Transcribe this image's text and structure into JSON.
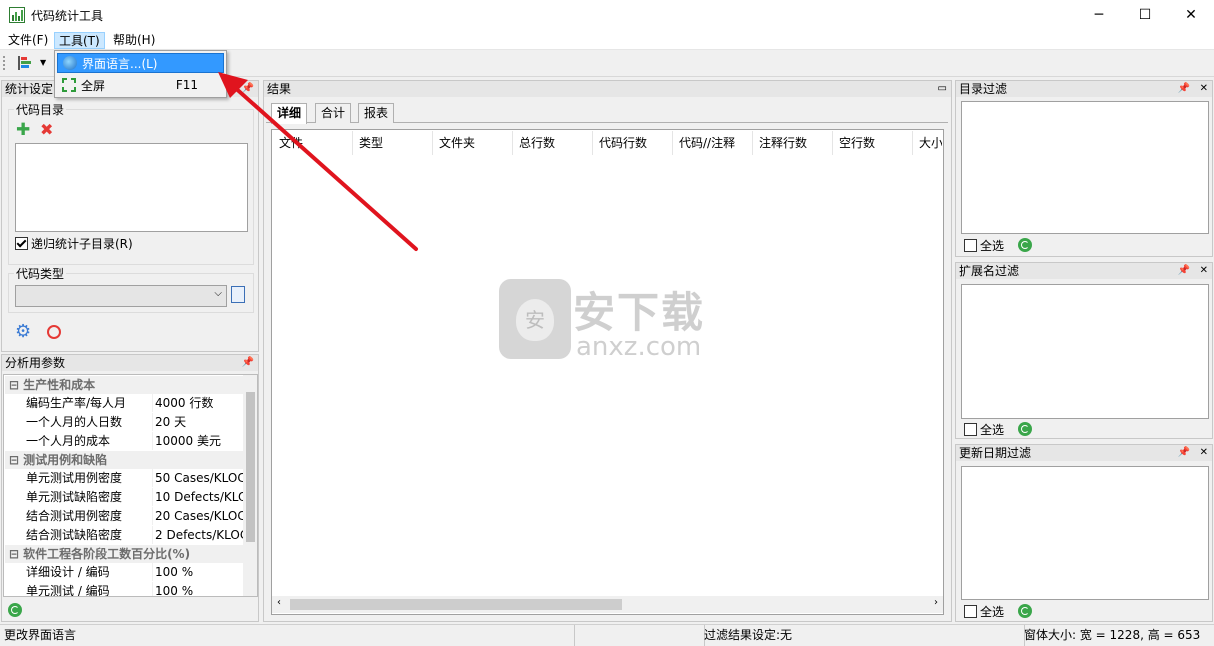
{
  "window": {
    "title": "代码统计工具",
    "min": "─",
    "max": "☐",
    "close": "✕"
  },
  "menu": {
    "file": "文件(F)",
    "tools": "工具(T)",
    "help": "帮助(H)"
  },
  "dropdown": {
    "items": [
      {
        "label": "界面语言...(L)",
        "shortcut": ""
      },
      {
        "label": "全屏",
        "shortcut": "F11"
      }
    ]
  },
  "stat_panel": {
    "title": "统计设定",
    "code_dir_label": "代码目录",
    "recurse_label": "递归统计子目录(R)",
    "recurse_checked": true,
    "code_type_label": "代码类型"
  },
  "params_panel": {
    "title": "分析用参数",
    "categories": [
      {
        "name": "生产性和成本",
        "rows": [
          {
            "name": "编码生产率/每人月",
            "value": "4000 行数"
          },
          {
            "name": "一个人月的人日数",
            "value": "20 天"
          },
          {
            "name": "一个人月的成本",
            "value": "10000 美元"
          }
        ]
      },
      {
        "name": "测试用例和缺陷",
        "rows": [
          {
            "name": "单元测试用例密度",
            "value": "50 Cases/KLOC"
          },
          {
            "name": "单元测试缺陷密度",
            "value": "10 Defects/KLOC"
          },
          {
            "name": "结合测试用例密度",
            "value": "20 Cases/KLOC"
          },
          {
            "name": "结合测试缺陷密度",
            "value": "2 Defects/KLOC"
          }
        ]
      },
      {
        "name": "软件工程各阶段工数百分比(%)",
        "rows": [
          {
            "name": "详细设计 / 编码",
            "value": "100 %"
          },
          {
            "name": "单元测试 / 编码",
            "value": "100 %"
          }
        ]
      }
    ]
  },
  "results": {
    "title": "结果",
    "tabs": [
      "详细",
      "合计",
      "报表"
    ],
    "columns": [
      "文件",
      "类型",
      "文件夹",
      "总行数",
      "代码行数",
      "代码//注释",
      "注释行数",
      "空行数",
      "大小"
    ]
  },
  "filters": {
    "dir": {
      "title": "目录过滤",
      "select_all": "全选"
    },
    "ext": {
      "title": "扩展名过滤",
      "select_all": "全选"
    },
    "date": {
      "title": "更新日期过滤",
      "select_all": "全选"
    }
  },
  "watermark": {
    "cn": "安下载",
    "en": "anxz.com",
    "badge": "安"
  },
  "status": {
    "left": "更改界面语言",
    "filter": "过滤结果设定:无",
    "size": "窗体大小: 宽 = 1228, 高 = 653"
  },
  "colors": {
    "highlight": "#3399ff",
    "arrow": "#e0141e",
    "accent_green": "#3aa64a"
  }
}
